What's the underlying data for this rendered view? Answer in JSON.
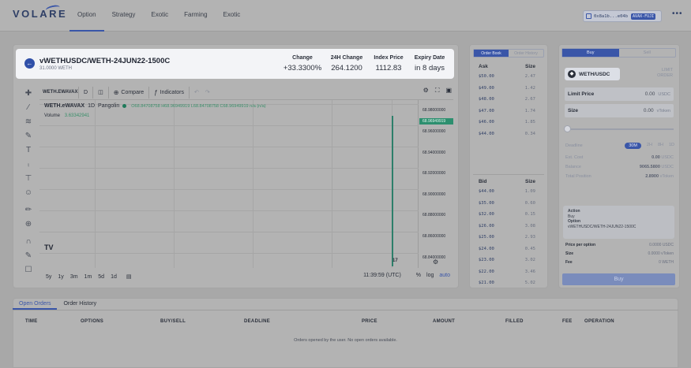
{
  "header": {
    "logo": "VOLARE",
    "nav": [
      "Option",
      "Strategy",
      "Exotic",
      "Farming",
      "Exotic"
    ],
    "active_nav": 0,
    "wallet_address": "0x8a1b...e04b",
    "wallet_chain": "AVAX-FUJI",
    "more": "•••"
  },
  "summary": {
    "pair": "vWETHUSDC/WETH-24JUN22-1500C",
    "amount": "31.0000 WETH",
    "stats": [
      {
        "label": "Change",
        "value": "+33.3300%"
      },
      {
        "label": "24H Change",
        "value": "264.1200"
      },
      {
        "label": "Index Price",
        "value": "1112.83"
      },
      {
        "label": "Expiry Date",
        "value": "in 8 days"
      }
    ]
  },
  "chart_toolbar": {
    "symbol": "WETH.EWAVAX",
    "interval": "D",
    "compare": "Compare",
    "indicators": "Indicators"
  },
  "chart": {
    "legend_symbol": "WETH.eWAVAX",
    "legend_interval": "1D",
    "legend_source": "Pangolin",
    "ohlc": "O68.84708758 H68.96949919 L68.84708758 C68.96949919 n/a (n/a)",
    "volume_label": "Volume",
    "volume_value": "3.63342941",
    "bottom_label": "17",
    "time": "11:39:59 (UTC)",
    "ranges": [
      "5y",
      "1y",
      "3m",
      "1m",
      "5d",
      "1d"
    ],
    "scale_opts": [
      "%",
      "log",
      "auto"
    ]
  },
  "chart_data": {
    "type": "bar",
    "price_ticks": [
      "68.98000000",
      "68.96000000",
      "68.94000000",
      "68.92000000",
      "68.90000000",
      "68.88000000",
      "68.86000000",
      "68.84000000"
    ],
    "last_price": "68.96949919",
    "ylim": [
      68.83,
      68.99
    ]
  },
  "order_book": {
    "tabs": [
      "Order Book",
      "Order History"
    ],
    "ask_header": [
      "Ask",
      "Size"
    ],
    "asks": [
      [
        "$50.00",
        "2.47"
      ],
      [
        "$49.00",
        "1.42"
      ],
      [
        "$48.00",
        "2.67"
      ],
      [
        "$47.00",
        "1.74"
      ],
      [
        "$46.00",
        "1.85"
      ],
      [
        "$44.00",
        "0.34"
      ]
    ],
    "bid_header": [
      "Bid",
      "Size"
    ],
    "bids": [
      [
        "$44.00",
        "1.09"
      ],
      [
        "$35.00",
        "0.60"
      ],
      [
        "$32.00",
        "0.15"
      ],
      [
        "$26.00",
        "3.08"
      ],
      [
        "$25.00",
        "2.93"
      ],
      [
        "$24.00",
        "0.45"
      ],
      [
        "$23.00",
        "3.02"
      ],
      [
        "$22.00",
        "3.46"
      ],
      [
        "$21.00",
        "5.02"
      ]
    ]
  },
  "trade": {
    "tabs": [
      "Buy",
      "Sell"
    ],
    "asset": "WETH/USDC",
    "order_type": "LIMIT ORDER",
    "limit_label": "Limit Price",
    "limit_value": "0.00",
    "limit_unit": "USDC",
    "size_label": "Size",
    "size_value": "0.00",
    "size_unit": "vToken",
    "deadline_label": "Deadline",
    "deadline_opts": [
      "30M",
      "2H",
      "8H",
      "1D"
    ],
    "info": [
      {
        "k": "Est. Cost",
        "v": "0.00",
        "u": "USDC"
      },
      {
        "k": "Balance",
        "v": "9065.5800",
        "u": "USDC"
      },
      {
        "k": "Total Position",
        "v": "2.8900",
        "u": "vToken"
      }
    ],
    "action_label": "Action",
    "action_value": "Buy",
    "option_label": "Option",
    "option_value": "vWETHUSDC/WETH-24JUN22-1500C",
    "summary": [
      {
        "k": "Price per option",
        "v": "0.0000 USDC"
      },
      {
        "k": "Size",
        "v": "0.0000 vToken"
      },
      {
        "k": "Fee",
        "v": "0 WETH"
      }
    ],
    "buy_button": "Buy"
  },
  "orders": {
    "tabs": [
      "Open Orders",
      "Order History"
    ],
    "columns": [
      "TIME",
      "OPTIONS",
      "BUY/SELL",
      "DEADLINE",
      "PRICE",
      "AMOUNT",
      "FILLED",
      "FEE",
      "OPERATION"
    ],
    "empty": "Orders opened by the user. No open orders available."
  }
}
